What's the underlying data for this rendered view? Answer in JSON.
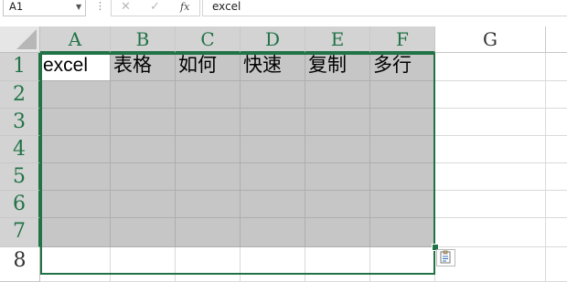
{
  "formula_bar": {
    "name_box": "A1",
    "name_box_arrow": "▼",
    "divider_dots": "⋮",
    "cancel_icon": "✕",
    "enter_icon": "✓",
    "fx_label": "fx",
    "content": "excel"
  },
  "columns": [
    "A",
    "B",
    "C",
    "D",
    "E",
    "F",
    "G"
  ],
  "rows": [
    "1",
    "2",
    "3",
    "4",
    "5",
    "6",
    "7",
    "8"
  ],
  "cells": {
    "A1": "excel",
    "B1": "表格",
    "C1": "如何",
    "D1": "快速",
    "E1": "复制",
    "F1": "多行"
  },
  "active_cell": "A1",
  "selection": "A1:F7",
  "paste_options_icon": "clipboard-icon",
  "colors": {
    "accent": "#217346",
    "selection_fill": "#c6c6c6",
    "header_fill": "#e8e8e8"
  }
}
